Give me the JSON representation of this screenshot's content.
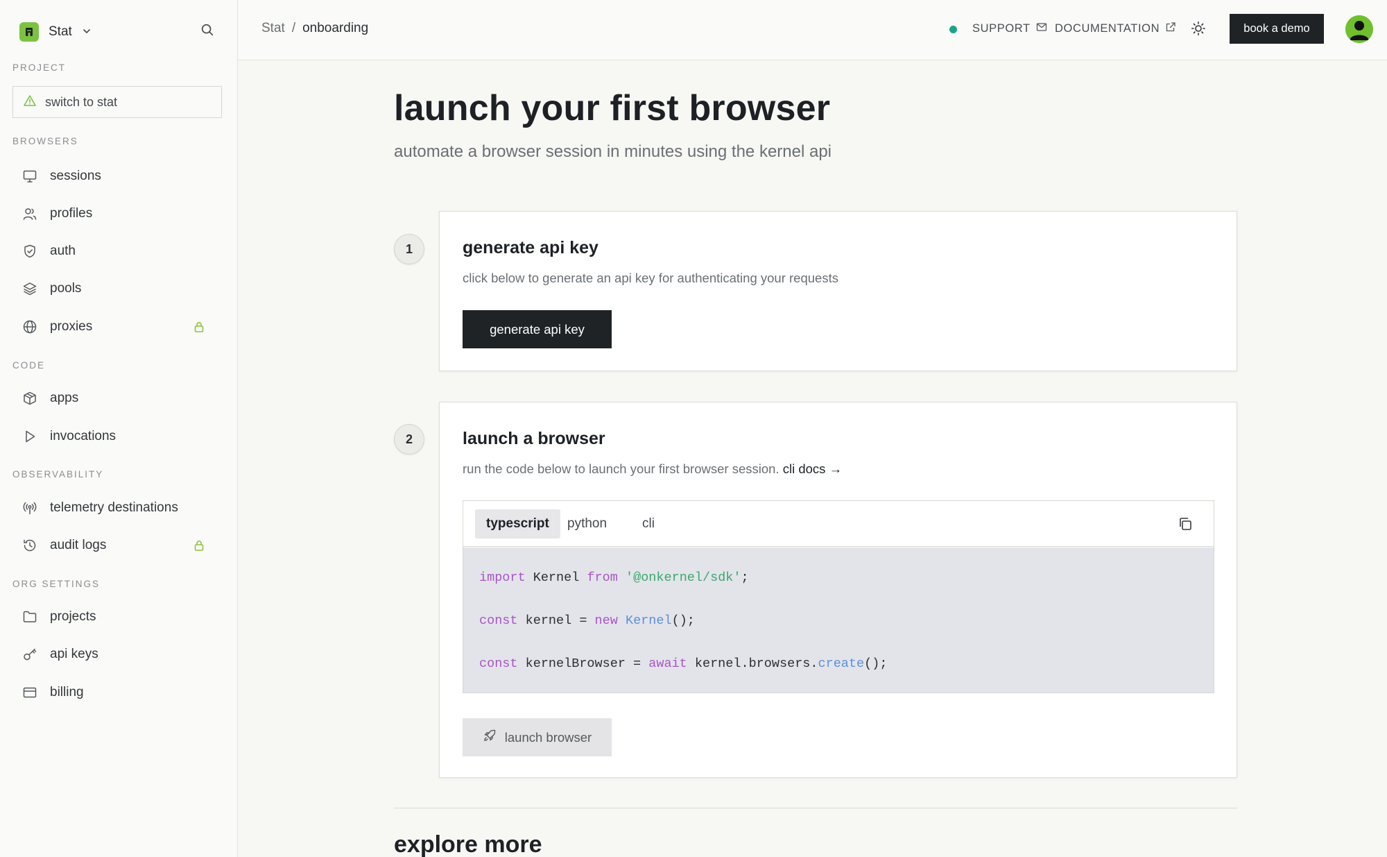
{
  "org": {
    "name": "Stat"
  },
  "sidebar": {
    "project_label": "PROJECT",
    "switch_label": "switch to stat",
    "sections": {
      "browsers": "BROWSERS",
      "code": "CODE",
      "observability": "OBSERVABILITY",
      "org_settings": "ORG SETTINGS"
    },
    "items": {
      "sessions": "sessions",
      "profiles": "profiles",
      "auth": "auth",
      "pools": "pools",
      "proxies": "proxies",
      "apps": "apps",
      "invocations": "invocations",
      "telemetry": "telemetry destinations",
      "audit_logs": "audit logs",
      "projects": "projects",
      "api_keys": "api keys",
      "billing": "billing"
    }
  },
  "header": {
    "breadcrumb_root": "Stat",
    "breadcrumb_sep": "/",
    "breadcrumb_current": "onboarding",
    "support": "SUPPORT",
    "documentation": "DOCUMENTATION",
    "demo_button": "book a demo"
  },
  "page": {
    "title": "launch your first browser",
    "subtitle": "automate a browser session in minutes using the kernel api"
  },
  "steps": {
    "one": {
      "number": "1",
      "title": "generate api key",
      "desc": "click below to generate an api key for authenticating your requests",
      "button": "generate api key"
    },
    "two": {
      "number": "2",
      "title": "launch a browser",
      "desc": "run the code below to launch your first browser session.",
      "link": "cli docs →",
      "tabs": {
        "typescript": "typescript",
        "python": "python",
        "cli": "cli"
      },
      "code": {
        "l1": {
          "kw1": "import",
          "t1": " Kernel ",
          "kw2": "from",
          "sp": " ",
          "str": "'@onkernel/sdk'",
          "end": ";"
        },
        "l2": {
          "kw1": "const",
          "t1": " kernel = ",
          "kw2": "new",
          "sp": " ",
          "fn": "Kernel",
          "end": "();"
        },
        "l3": {
          "kw1": "const",
          "t1": " kernelBrowser = ",
          "kw2": "await",
          "t2": " kernel.browsers.",
          "fn": "create",
          "end": "();"
        }
      },
      "launch_button": "launch browser"
    }
  },
  "explore_title": "explore more",
  "colors": {
    "accent": "#7cc242",
    "status": "#1aa38a",
    "button_dark": "#1f2326"
  }
}
